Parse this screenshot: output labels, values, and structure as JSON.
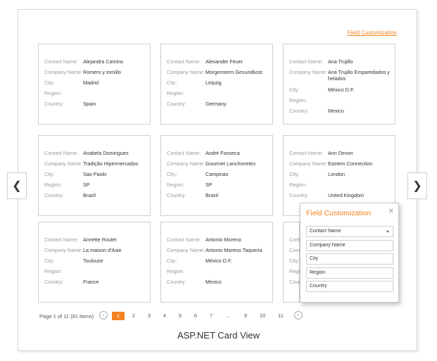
{
  "toolbar": {
    "field_customization_link": "Field Customization"
  },
  "labels": {
    "contact": "Contact Name:",
    "company": "Company Name:",
    "city": "City:",
    "region": "Region:",
    "country": "Country:"
  },
  "cards": [
    {
      "contact": "Alejandra Camino",
      "company": "Romero y tomillo",
      "city": "Madrid",
      "region": "",
      "country": "Spain"
    },
    {
      "contact": "Alexander Feuer",
      "company": "Morgenstern Gesundkost",
      "city": "Leipzig",
      "region": "",
      "country": "Germany"
    },
    {
      "contact": "Ana Trujillo",
      "company": "Ana Trujillo Emparedados y helados",
      "city": "México D.F.",
      "region": "",
      "country": "Mexico"
    },
    {
      "contact": "Anabela Domingues",
      "company": "Tradição Hipermercados",
      "city": "Sao Paulo",
      "region": "SP",
      "country": "Brazil"
    },
    {
      "contact": "André Fonseca",
      "company": "Gourmet Lanchonetes",
      "city": "Campinas",
      "region": "SP",
      "country": "Brazil"
    },
    {
      "contact": "Ann Devon",
      "company": "Eastern Connection",
      "city": "London",
      "region": "",
      "country": "United Kingdom"
    },
    {
      "contact": "Annette Roulet",
      "company": "La maison d'Asie",
      "city": "Toulouse",
      "region": "",
      "country": "France"
    },
    {
      "contact": "Antonio Moreno",
      "company": "Antonio Moreno Taquería",
      "city": "México D.F.",
      "region": "",
      "country": "Mexico"
    },
    {
      "contact": "Conta",
      "company": "Comp",
      "city": "City:",
      "region": "Regio",
      "country": "Coun"
    }
  ],
  "nav": {
    "prev_icon": "chevron-left-icon",
    "next_icon": "chevron-right-icon",
    "prev_glyph": "❮",
    "next_glyph": "❯"
  },
  "pager": {
    "summary": "Page 1 of 11 (91 items)",
    "prev_glyph": "‹",
    "next_glyph": "›",
    "pages": [
      "1",
      "2",
      "3",
      "4",
      "5",
      "6",
      "7",
      "...",
      "9",
      "10",
      "11"
    ],
    "current": "1"
  },
  "caption": "ASP.NET Card View",
  "popup": {
    "title": "Field Customization",
    "close_glyph": "✕",
    "items": [
      "Contact Name",
      "Company Name",
      "City",
      "Region",
      "Country"
    ],
    "caret": "▲"
  },
  "colors": {
    "accent": "#f58220",
    "border": "#cfcfcf",
    "label": "#9a9a9a"
  }
}
